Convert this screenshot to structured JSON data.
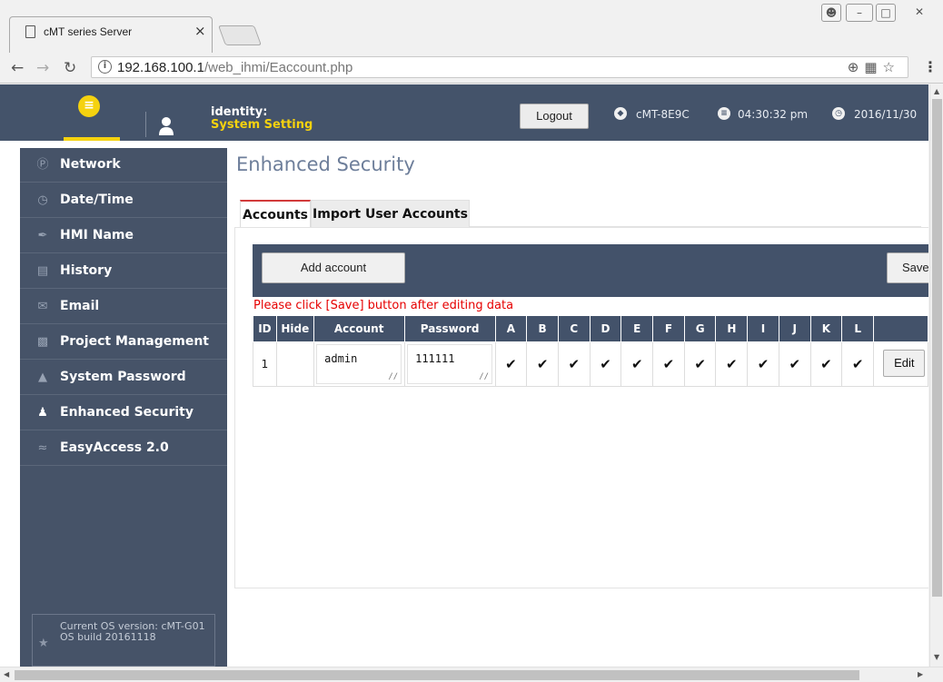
{
  "browser": {
    "tab_title": "cMT series Server",
    "close_glyph": "×",
    "url_host": "192.168.100.1",
    "url_path": "/web_ihmi/Eaccount.php"
  },
  "header": {
    "identity_label": "identity:",
    "identity_value": "System Setting",
    "logout_label": "Logout",
    "device_name": "cMT-8E9C",
    "time": "04:30:32 pm",
    "date": "2016/11/30"
  },
  "sidebar": {
    "items": [
      {
        "label": "Network",
        "icon": "ip-icon"
      },
      {
        "label": "Date/Time",
        "icon": "clock-icon"
      },
      {
        "label": "HMI Name",
        "icon": "pen-icon"
      },
      {
        "label": "History",
        "icon": "document-icon"
      },
      {
        "label": "Email",
        "icon": "mail-icon"
      },
      {
        "label": "Project Management",
        "icon": "project-icon"
      },
      {
        "label": "System Password",
        "icon": "lock-icon"
      },
      {
        "label": "Enhanced Security",
        "icon": "users-icon"
      },
      {
        "label": "EasyAccess 2.0",
        "icon": "easyaccess-icon"
      }
    ],
    "os_version": "Current OS version: cMT-G01 OS build 20161118"
  },
  "main": {
    "title": "Enhanced Security",
    "tabs": [
      "Accounts",
      "Import User Accounts"
    ],
    "add_button": "Add account",
    "save_button": "Save",
    "hint": "Please click [Save] button after editing data",
    "columns": [
      "ID",
      "Hide",
      "Account",
      "Password",
      "A",
      "B",
      "C",
      "D",
      "E",
      "F",
      "G",
      "H",
      "I",
      "J",
      "K",
      "L",
      ""
    ],
    "rows": [
      {
        "id": "1",
        "hide": "",
        "account": "admin",
        "password": "111111",
        "checks": [
          "✔",
          "✔",
          "✔",
          "✔",
          "✔",
          "✔",
          "✔",
          "✔",
          "✔",
          "✔",
          "✔",
          "✔"
        ],
        "edit": "Edit"
      }
    ]
  },
  "colors": {
    "header_bg": "#44536a",
    "accent_yellow": "#f5d20f",
    "hint_red": "#e60000"
  }
}
